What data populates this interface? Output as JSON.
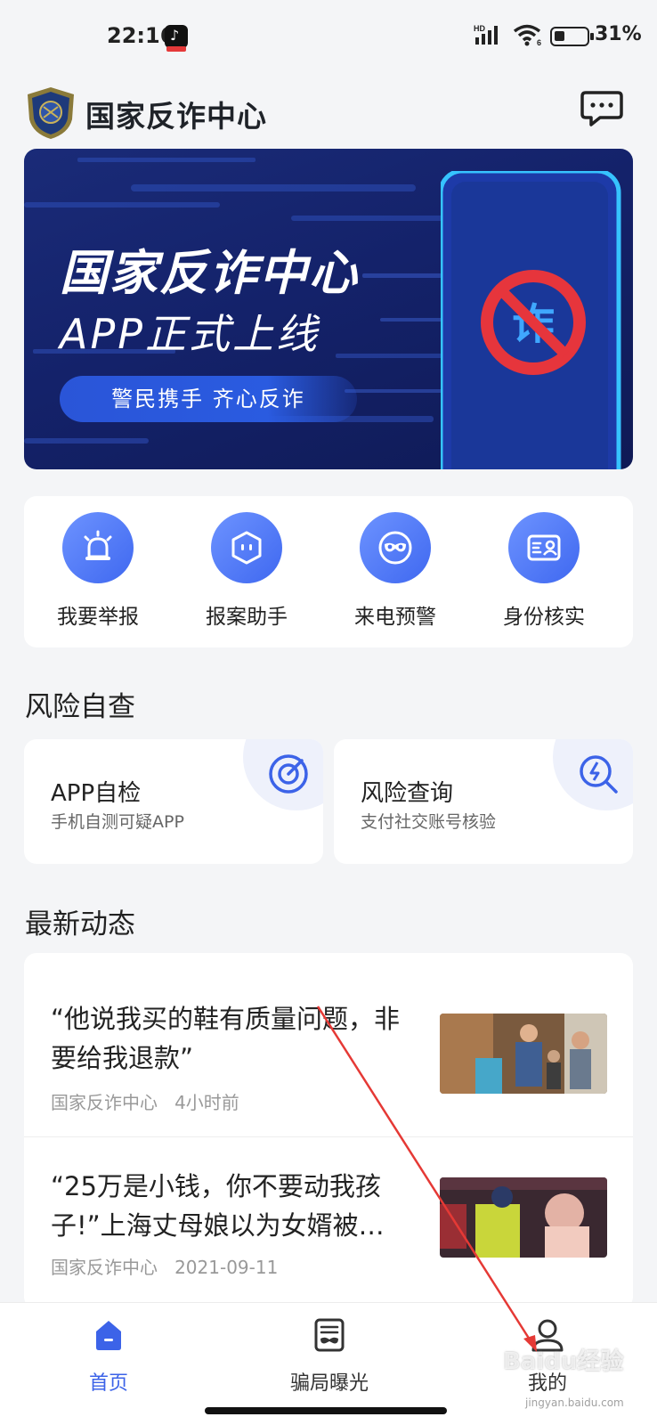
{
  "status_bar": {
    "time": "22:16",
    "battery_percent": "31%",
    "battery_level": 0.31,
    "network": "HD",
    "wifi_label": "6",
    "icons": [
      "tiktok-icon",
      "signal-icon",
      "wifi-icon",
      "battery-icon"
    ]
  },
  "header": {
    "title": "国家反诈中心",
    "logo_icon": "police-badge-icon",
    "message_icon": "message-icon"
  },
  "banner": {
    "title": "国家反诈中心",
    "subtitle": "APP正式上线",
    "pill_text": "警民携手  齐心反诈",
    "phone_glyph": "诈"
  },
  "quick_actions": [
    {
      "label": "我要举报",
      "icon": "alarm-light-icon"
    },
    {
      "label": "报案助手",
      "icon": "hexagon-face-icon"
    },
    {
      "label": "来电预警",
      "icon": "mask-icon"
    },
    {
      "label": "身份核实",
      "icon": "id-card-icon"
    }
  ],
  "risk_section": {
    "title": "风险自查",
    "cards": [
      {
        "title": "APP自检",
        "subtitle": "手机自测可疑APP",
        "icon": "target-icon"
      },
      {
        "title": "风险查询",
        "subtitle": "支付社交账号核验",
        "icon": "search-bolt-icon"
      }
    ]
  },
  "news_section": {
    "title": "最新动态",
    "items": [
      {
        "title": "“他说我买的鞋有质量问题，非要给我退款”",
        "source": "国家反诈中心",
        "time": "4小时前"
      },
      {
        "title": "“25万是小钱，你不要动我孩子!”上海丈母娘以为女婿被…",
        "source": "国家反诈中心",
        "time": "2021-09-11"
      }
    ]
  },
  "bottom_nav": [
    {
      "label": "首页",
      "icon": "home-icon",
      "active": true
    },
    {
      "label": "骗局曝光",
      "icon": "exposure-icon",
      "active": false
    },
    {
      "label": "我的",
      "icon": "user-icon",
      "active": false
    }
  ],
  "watermark": {
    "text": "Baidu经验",
    "sub": "jingyan.baidu.com"
  },
  "colors": {
    "accent": "#3c63e8",
    "banner": "#14226a",
    "background": "#f4f5f7",
    "annotation_arrow": "#e53935"
  }
}
